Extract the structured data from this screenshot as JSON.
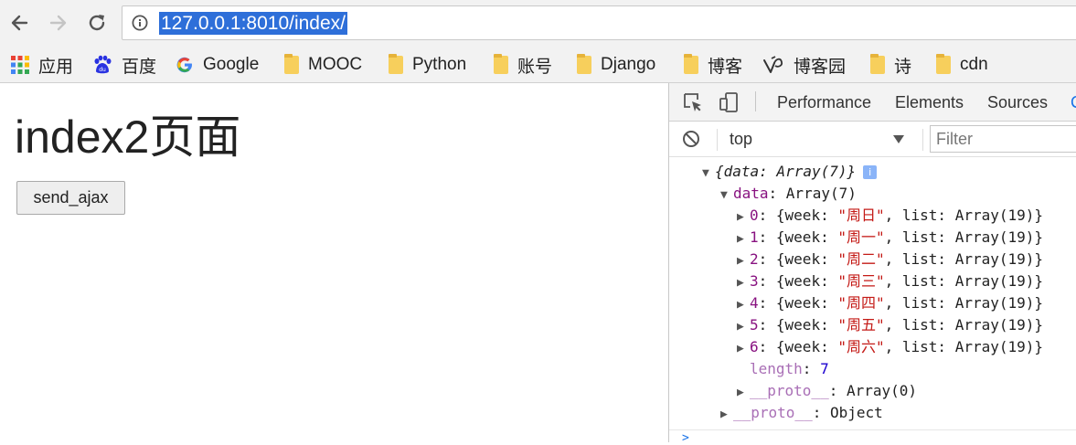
{
  "browser": {
    "url": "127.0.0.1:8010/index/",
    "bookmarks": [
      {
        "label": "应用",
        "icon": "apps-grid-icon"
      },
      {
        "label": "百度",
        "icon": "baidu-paw-icon"
      },
      {
        "label": "Google",
        "icon": "google-g-icon"
      },
      {
        "label": "MOOC",
        "icon": "folder-icon"
      },
      {
        "label": "Python",
        "icon": "folder-icon"
      },
      {
        "label": "账号",
        "icon": "folder-icon"
      },
      {
        "label": "Django",
        "icon": "folder-icon"
      },
      {
        "label": "博客",
        "icon": "folder-icon"
      },
      {
        "label": "博客园",
        "icon": "cnblogs-icon"
      },
      {
        "label": "诗",
        "icon": "folder-icon"
      },
      {
        "label": "cdn",
        "icon": "folder-icon"
      }
    ]
  },
  "page": {
    "title": "index2页面",
    "button_label": "send_ajax"
  },
  "devtools": {
    "tabs": [
      "Performance",
      "Elements",
      "Sources",
      "C"
    ],
    "context": "top",
    "filter_placeholder": "Filter",
    "console": {
      "root_preview": "{data: Array(7)}",
      "info_badge": "i",
      "data_key": "data",
      "data_value": "Array(7)",
      "items": [
        {
          "index": "0",
          "week": "\"周日\""
        },
        {
          "index": "1",
          "week": "\"周一\""
        },
        {
          "index": "2",
          "week": "\"周二\""
        },
        {
          "index": "3",
          "week": "\"周三\""
        },
        {
          "index": "4",
          "week": "\"周四\""
        },
        {
          "index": "5",
          "week": "\"周五\""
        },
        {
          "index": "6",
          "week": "\"周六\""
        }
      ],
      "item_open": ": {week: ",
      "item_list": ", list: ",
      "item_list_value": "Array(19)}",
      "length_key": "length",
      "length_value": "7",
      "proto_key": "__proto__",
      "inner_proto_value": "Array(0)",
      "outer_proto_value": "Object"
    }
  },
  "colors": {
    "url_highlight": "#2e6fd9",
    "key": "#881280",
    "string": "#c41a16",
    "number": "#1c00cf"
  }
}
